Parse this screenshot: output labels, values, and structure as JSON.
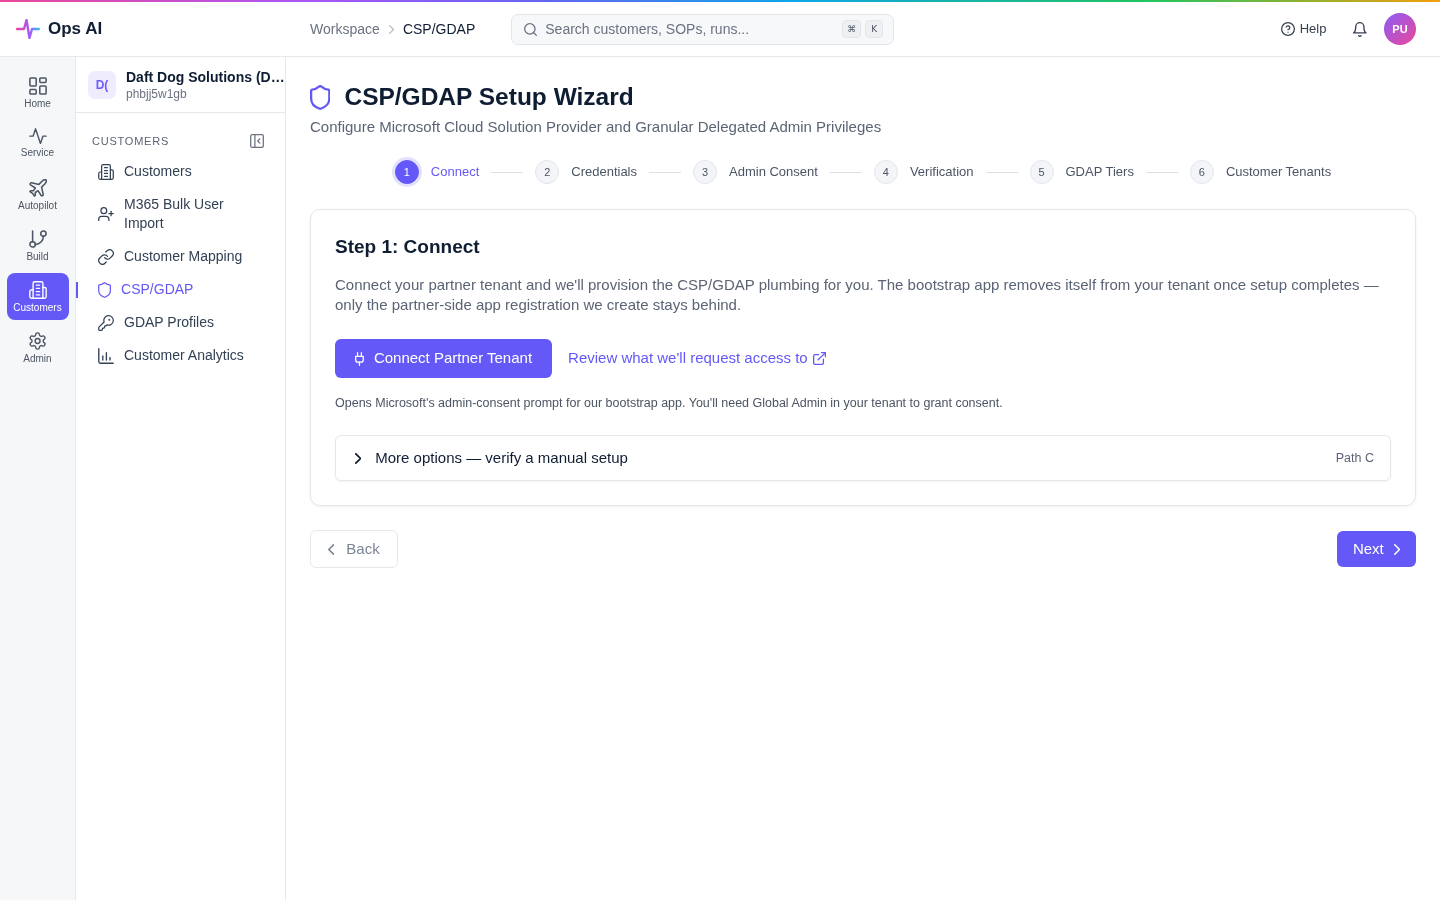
{
  "app": {
    "name": "Ops AI"
  },
  "breadcrumb": [
    "Workspace",
    "CSP/GDAP"
  ],
  "search": {
    "placeholder": "Search customers, SOPs, runs...",
    "shortcut_keys": [
      "⌘",
      "K"
    ]
  },
  "header_actions": {
    "help": "Help",
    "avatar_initials": "PU"
  },
  "rail": [
    {
      "label": "Home",
      "selected": false
    },
    {
      "label": "Service",
      "selected": false
    },
    {
      "label": "Autopilot",
      "selected": false
    },
    {
      "label": "Build",
      "selected": false
    },
    {
      "label": "Customers",
      "selected": true
    },
    {
      "label": "Admin",
      "selected": false
    }
  ],
  "workspace": {
    "initials": "D(",
    "name": "Daft Dog Solutions (D…",
    "id": "phbjj5w1gb"
  },
  "section_nav": {
    "heading": "CUSTOMERS",
    "items": [
      {
        "label": "Customers",
        "selected": false
      },
      {
        "label": "M365 Bulk User Import",
        "selected": false
      },
      {
        "label": "Customer Mapping",
        "selected": false
      },
      {
        "label": "CSP/GDAP",
        "selected": true
      },
      {
        "label": "GDAP Profiles",
        "selected": false
      },
      {
        "label": "Customer Analytics",
        "selected": false
      }
    ]
  },
  "page": {
    "title": "CSP/GDAP Setup Wizard",
    "subtitle": "Configure Microsoft Cloud Solution Provider and Granular Delegated Admin Privileges"
  },
  "steps": [
    {
      "number": "1",
      "label": "Connect",
      "selected": true
    },
    {
      "number": "2",
      "label": "Credentials",
      "selected": false
    },
    {
      "number": "3",
      "label": "Admin Consent",
      "selected": false
    },
    {
      "number": "4",
      "label": "Verification",
      "selected": false
    },
    {
      "number": "5",
      "label": "GDAP Tiers",
      "selected": false
    },
    {
      "number": "6",
      "label": "Customer Tenants",
      "selected": false
    }
  ],
  "card": {
    "title": "Step 1: Connect",
    "description": "Connect your partner tenant and we'll provision the CSP/GDAP plumbing for you. The bootstrap app removes itself from your tenant once setup completes — only the partner-side app registration we create stays behind.",
    "primary_button": "Connect Partner Tenant",
    "link": "Review what we'll request access to",
    "note": "Opens Microsoft's admin-consent prompt for our bootstrap app. You'll need Global Admin in your tenant to grant consent.",
    "more_options": {
      "label": "More options — verify a manual setup",
      "tag": "Path C",
      "expanded": false
    }
  },
  "footer": {
    "back": {
      "label": "Back",
      "disabled": true
    },
    "next": {
      "label": "Next"
    }
  }
}
